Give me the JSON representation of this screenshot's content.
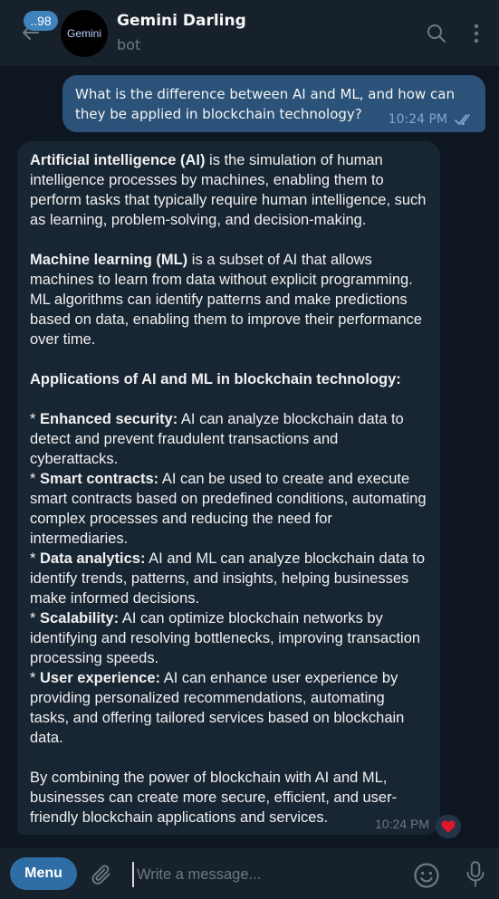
{
  "header": {
    "unread_count": "..98",
    "avatar_text": "Gemini",
    "title": "Gemini Darling",
    "subtitle": "bot",
    "icons": [
      "back-arrow-icon",
      "search-icon",
      "more-vert-icon"
    ]
  },
  "messages": {
    "outgoing": {
      "text": "What is the difference between AI and ML, and how can they be applied in blockchain technology?",
      "time": "10:24 PM",
      "status": "read"
    },
    "incoming": {
      "p1": {
        "bold": "Artificial intelligence (AI)",
        "rest": " is the simulation of human intelligence processes by machines, enabling them to perform tasks that typically require human intelligence, such as learning, problem-solving, and decision-making."
      },
      "p2": {
        "bold": "Machine learning (ML)",
        "rest": " is a subset of AI that allows machines to learn from data without explicit programming. ML algorithms can identify patterns and make predictions based on data, enabling them to improve their performance over time."
      },
      "apps_heading": "Applications of AI and ML in blockchain technology:",
      "bullets": [
        {
          "prefix": "* ",
          "bold": "Enhanced security:",
          "rest": " AI can analyze blockchain data to detect and prevent fraudulent transactions and cyberattacks."
        },
        {
          "prefix": "* ",
          "bold": "Smart contracts:",
          "rest": " AI can be used to create and execute smart contracts based on predefined conditions, automating complex processes and reducing the need for intermediaries."
        },
        {
          "prefix": "* ",
          "bold": "Data analytics:",
          "rest": " AI and ML can analyze blockchain data to identify trends, patterns, and insights, helping businesses make informed decisions."
        },
        {
          "prefix": "* ",
          "bold": "Scalability:",
          "rest": " AI can optimize blockchain networks by identifying and resolving bottlenecks, improving transaction processing speeds."
        },
        {
          "prefix": "* ",
          "bold": "User experience:",
          "rest": " AI can enhance user experience by providing personalized recommendations, automating tasks, and offering tailored services based on blockchain data."
        }
      ],
      "conclusion": "By combining the power of blockchain with AI and ML, businesses can create more secure, efficient, and user-friendly blockchain applications and services.",
      "time": "10:24 PM",
      "reaction": "heart-icon"
    }
  },
  "composer": {
    "menu_label": "Menu",
    "placeholder": "Write a message...",
    "icons": [
      "attach-icon",
      "emoji-icon",
      "microphone-icon"
    ]
  },
  "colors": {
    "background": "#0e1621",
    "header": "#17212b",
    "outgoing_bubble": "#2b5278",
    "incoming_bubble": "#182533",
    "accent": "#2f6ea5",
    "reaction_heart": "#e0162b"
  }
}
